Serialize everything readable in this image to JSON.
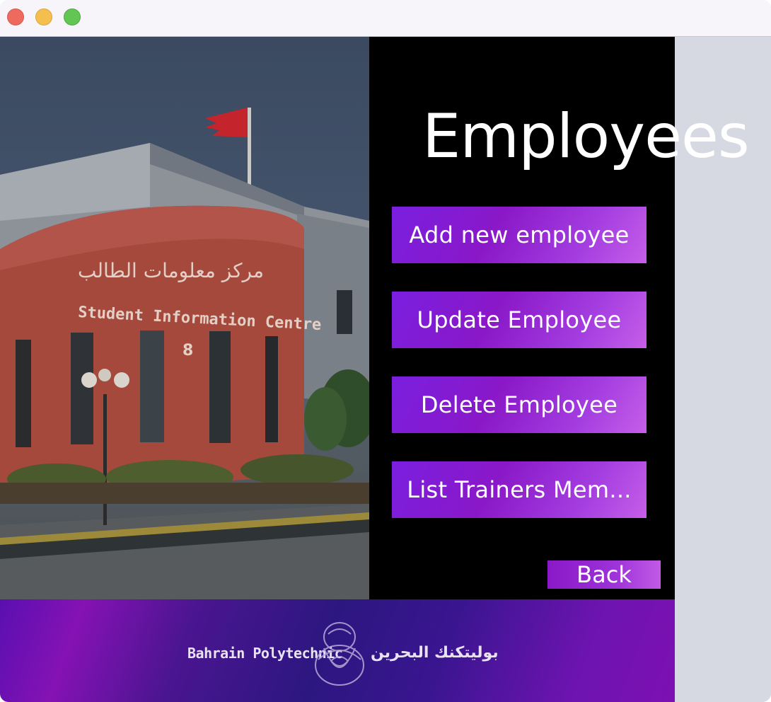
{
  "window": {
    "controls": [
      "close-icon",
      "minimize-icon",
      "maximize-icon"
    ]
  },
  "photo": {
    "sign_arabic": "مركز معلومات الطالب",
    "sign_english": "Student Information Centre",
    "building_number": "8"
  },
  "page": {
    "title": "Employees"
  },
  "menu": {
    "add_label": "Add new employee",
    "update_label": "Update Employee",
    "delete_label": "Delete Employee",
    "list_label": "List Trainers Mem...",
    "back_label": "Back"
  },
  "footer": {
    "english_name": "Bahrain Polytechnic",
    "arabic_name": "بوليتكنك البحرين"
  },
  "colors": {
    "button_gradient_start": "#7a1fe0",
    "button_gradient_end": "#c65ee8",
    "panel_background": "#000000",
    "footer_primary": "#2c1780"
  }
}
